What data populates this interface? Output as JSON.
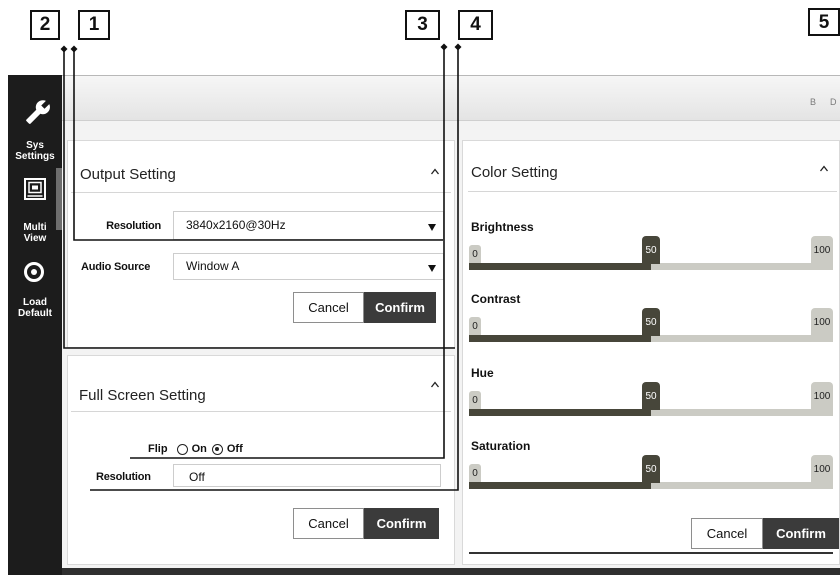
{
  "callouts": {
    "c1": "1",
    "c2": "2",
    "c3": "3",
    "c4": "4",
    "c5": "5"
  },
  "sidebar": {
    "items": [
      {
        "icon": "wrench-icon",
        "label_line1": "Sys",
        "label_line2": "Settings"
      },
      {
        "icon": "multi-view-icon",
        "label_line1": "Multi",
        "label_line2": "View"
      },
      {
        "icon": "load-default-icon",
        "label_line1": "Load",
        "label_line2": "Default"
      }
    ]
  },
  "header": {
    "controls": [
      "B",
      "D"
    ]
  },
  "output_setting": {
    "title": "Output Setting",
    "collapse_icon": "chevron-up-icon",
    "resolution": {
      "label": "Resolution",
      "value": "3840x2160@30Hz"
    },
    "audio_source": {
      "label": "Audio Source",
      "value": "Window A"
    },
    "cancel_label": "Cancel",
    "confirm_label": "Confirm"
  },
  "full_screen_setting": {
    "title": "Full Screen Setting",
    "collapse_icon": "chevron-up-icon",
    "flip": {
      "label": "Flip",
      "options": [
        "On",
        "Off"
      ],
      "selected_index": 1
    },
    "resolution": {
      "label": "Resolution",
      "value": "Off"
    },
    "cancel_label": "Cancel",
    "confirm_label": "Confirm"
  },
  "color_setting": {
    "title": "Color Setting",
    "collapse_icon": "chevron-up-icon",
    "sliders": [
      {
        "label": "Brightness",
        "min": 0,
        "max": 100,
        "value": 50
      },
      {
        "label": "Contrast",
        "min": 0,
        "max": 100,
        "value": 50
      },
      {
        "label": "Hue",
        "min": 0,
        "max": 100,
        "value": 50
      },
      {
        "label": "Saturation",
        "min": 0,
        "max": 100,
        "value": 50
      }
    ],
    "cancel_label": "Cancel",
    "confirm_label": "Confirm"
  },
  "colors": {
    "sidebar": "#1c1c1c",
    "confirm": "#3b3b3b",
    "slider_fill": "#47463a",
    "slider_rest": "#cbcbc4"
  }
}
